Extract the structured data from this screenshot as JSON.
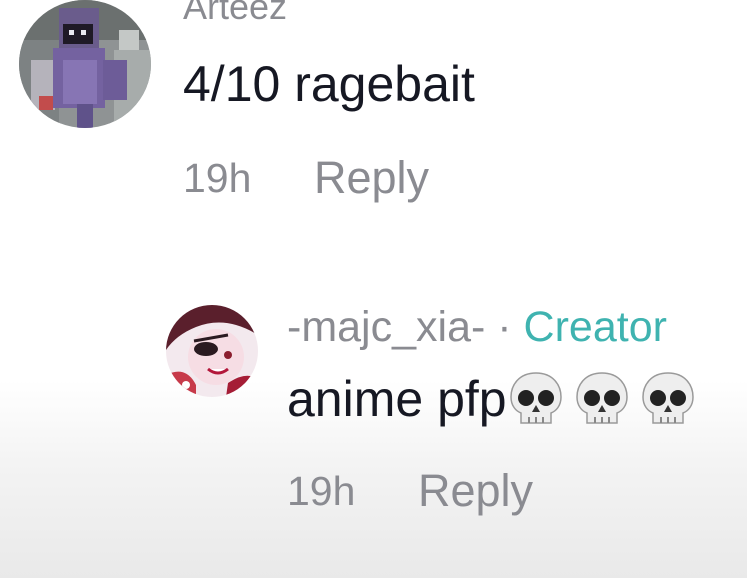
{
  "comments": [
    {
      "username": "Arteez",
      "text": "4/10 ragebait",
      "time": "19h",
      "reply_label": "Reply",
      "avatar_icon": "pixel-character-avatar"
    },
    {
      "username": "-majc_xia-",
      "separator": "·",
      "badge": "Creator",
      "text": "anime pfp",
      "emoji": [
        "skull",
        "skull",
        "skull"
      ],
      "time": "19h",
      "reply_label": "Reply",
      "avatar_icon": "anime-character-avatar"
    }
  ],
  "colors": {
    "muted": "#8a8b91",
    "text": "#161823",
    "creator_badge": "#3fb3b0"
  }
}
